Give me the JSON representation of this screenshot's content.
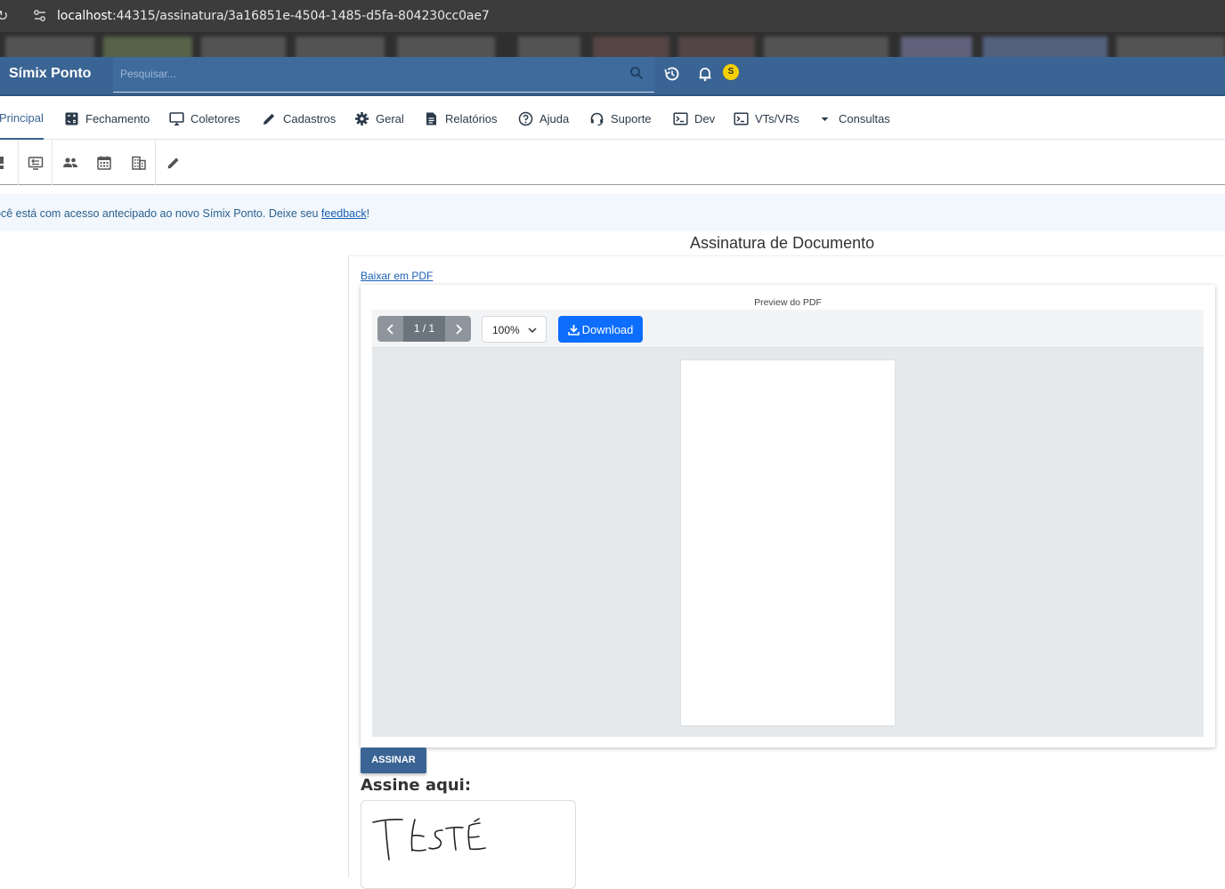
{
  "browser": {
    "url_host": "localhost",
    "url_rest": ":44315/assinatura/3a16851e-4504-1485-d5fa-804230cc0ae7"
  },
  "header": {
    "title": "Símix Ponto",
    "search_placeholder": "Pesquisar...",
    "avatar_initial": "S",
    "avatar_color": "#f5d000",
    "bar_color": "#3a6493"
  },
  "nav": {
    "items": [
      {
        "label": "Principal",
        "icon": "home-icon",
        "active": true
      },
      {
        "label": "Fechamento",
        "icon": "calculator-icon"
      },
      {
        "label": "Coletores",
        "icon": "monitor-icon"
      },
      {
        "label": "Cadastros",
        "icon": "pencil-icon"
      },
      {
        "label": "Geral",
        "icon": "gear-icon"
      },
      {
        "label": "Relatórios",
        "icon": "document-icon"
      },
      {
        "label": "Ajuda",
        "icon": "help-icon"
      },
      {
        "label": "Suporte",
        "icon": "headset-icon"
      },
      {
        "label": "Dev",
        "icon": "terminal-icon"
      },
      {
        "label": "VTs/VRs",
        "icon": "terminal-icon"
      },
      {
        "label": "Consultas",
        "icon": "caret-down-icon"
      }
    ]
  },
  "banner": {
    "text": "ocê está com acesso antecipado ao novo Símix Ponto. Deixe seu ",
    "link": "feedback",
    "suffix": "!"
  },
  "page": {
    "title": "Assinatura de Documento",
    "pdf_link": "Baixar em PDF"
  },
  "pdf": {
    "caption": "Preview do PDF",
    "page_indicator": "1 / 1",
    "zoom": "100%",
    "download_label": "Download"
  },
  "sign": {
    "button": "ASSINAR",
    "label": "Assine aqui:"
  }
}
